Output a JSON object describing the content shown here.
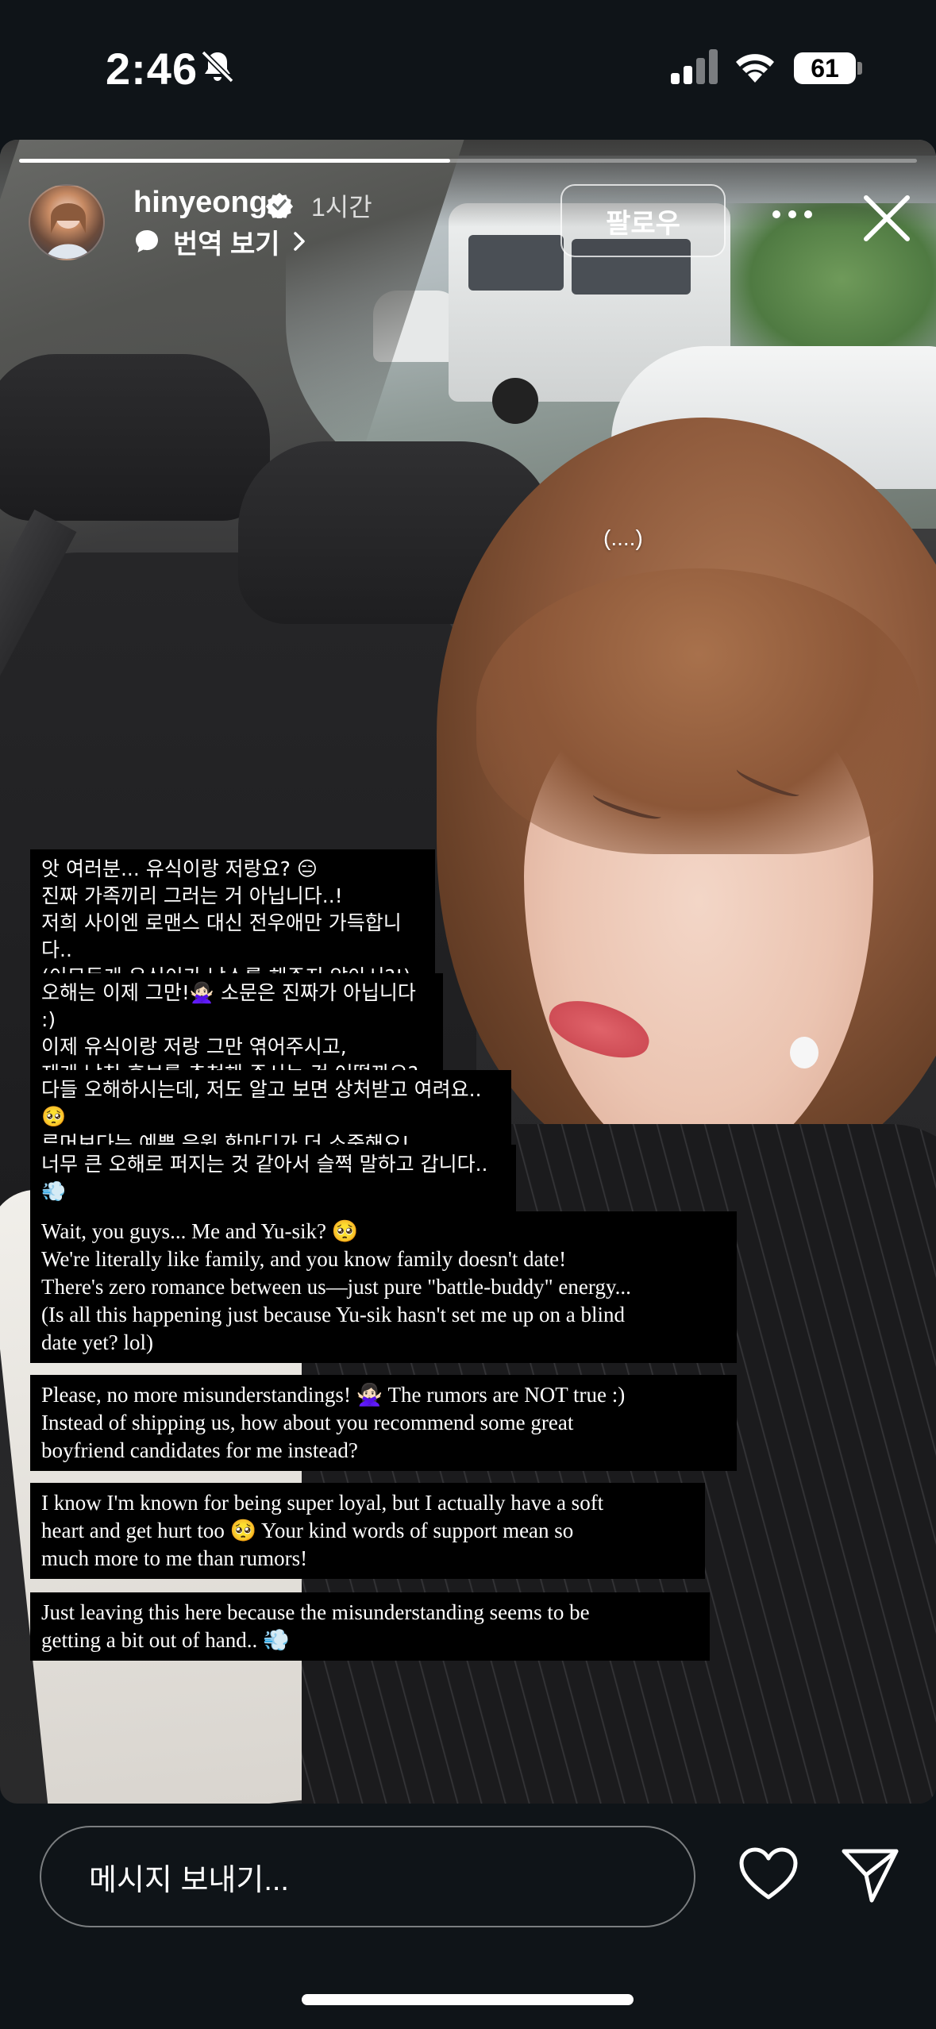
{
  "status_bar": {
    "time": "2:46",
    "battery": "61",
    "icons": [
      "bell-slash-icon",
      "cellular-signal-icon",
      "wifi-icon",
      "battery-icon"
    ]
  },
  "story": {
    "progress_fraction": 0.48,
    "username": "hinyeong",
    "time_ago": "1시간",
    "translate_label": "번역 보기",
    "follow_label": "팔로우",
    "overlay_text": "(....)",
    "captions_ko": [
      "앗 여러분... 유식이랑 저랑요? 😑\n진짜 가족끼리 그러는 거 아닙니다..!\n저희 사이엔 로맨스 대신 전우애만 가득합니다..\n(이모든게 유식이가 남소를 해주지 않아서?!)",
      "오해는 이제 그만!🙅🏻‍♀️ 소문은 진짜가 아닙니다 :)\n이제 유식이랑 저랑 그만 엮어주시고,\n제게 남친 후보를 추천해 주시는 건 어떨까요?",
      "다들 오해하시는데, 저도 알고 보면 상처받고 여려요..🥺\n루머보다는 예쁜 응원 한마디가 더 소중해요!",
      "너무 큰 오해로 퍼지는 것 같아서 슬쩍 말하고 갑니다..💨"
    ],
    "captions_en": [
      "Wait, you guys... Me and Yu-sik? 🥺\nWe're literally like family, and you know family doesn't date!\nThere's zero romance between us—just pure \"battle-buddy\" energy...\n(Is all this happening just because Yu-sik hasn't set me up on a blind\ndate yet? lol)",
      "Please, no more misunderstandings! 🙅🏻‍♀️ The rumors are NOT true :)\nInstead of shipping us, how about you recommend some great\nboyfriend candidates for me instead?",
      "I know I'm known for being super loyal, but I actually have a soft\nheart and get hurt too 🥺 Your kind words of support mean so\nmuch more to me than rumors!",
      "Just leaving this here because the misunderstanding seems to be\ngetting a bit out of hand.. 💨"
    ]
  },
  "bottom_bar": {
    "message_placeholder": "메시지 보내기..."
  }
}
